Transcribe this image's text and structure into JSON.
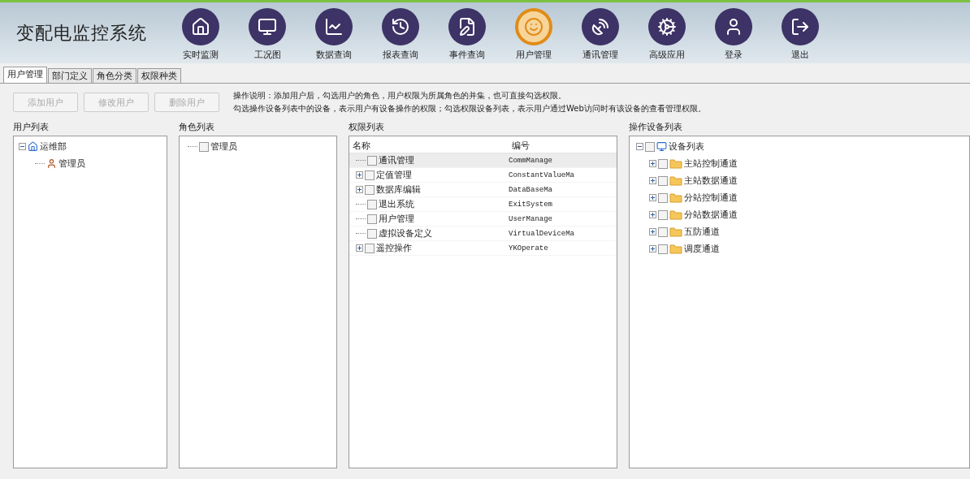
{
  "app_title": "变配电监控系统",
  "nav": [
    {
      "label": "实时监测",
      "selected": false
    },
    {
      "label": "工况图",
      "selected": false
    },
    {
      "label": "数据查询",
      "selected": false
    },
    {
      "label": "报表查询",
      "selected": false
    },
    {
      "label": "事件查询",
      "selected": false
    },
    {
      "label": "用户管理",
      "selected": true
    },
    {
      "label": "通讯管理",
      "selected": false
    },
    {
      "label": "高级应用",
      "selected": false
    },
    {
      "label": "登录",
      "selected": false
    },
    {
      "label": "退出",
      "selected": false
    }
  ],
  "tabs": [
    {
      "label": "用户管理",
      "selected": true
    },
    {
      "label": "部门定义",
      "selected": false
    },
    {
      "label": "角色分类",
      "selected": false
    },
    {
      "label": "权限种类",
      "selected": false
    }
  ],
  "buttons": [
    {
      "label": "添加用户",
      "disabled": true
    },
    {
      "label": "修改用户",
      "disabled": true
    },
    {
      "label": "删除用户",
      "disabled": true
    }
  ],
  "instructions": [
    "操作说明：添加用户后，勾选用户的角色，用户权限为所属角色的并集，也可直接勾选权限。",
    "勾选操作设备列表中的设备，表示用户有设备操作的权限；勾选权限设备列表，表示用户通过Web访问时有该设备的查看管理权限。"
  ],
  "user_list": {
    "title": "用户列表",
    "root": {
      "label": "运维部",
      "expanded": true,
      "children": [
        {
          "label": "管理员"
        }
      ]
    }
  },
  "role_list": {
    "title": "角色列表",
    "items": [
      {
        "label": "管理员",
        "checked": false
      }
    ]
  },
  "permission_list": {
    "title": "权限列表",
    "columns": [
      "名称",
      "编号"
    ],
    "rows": [
      {
        "name": "通讯管理",
        "code": "CommManage",
        "checked": false,
        "expandable": false,
        "selected": true
      },
      {
        "name": "定值管理",
        "code": "ConstantValueMa",
        "checked": false,
        "expandable": true,
        "selected": false
      },
      {
        "name": "数据库编辑",
        "code": "DataBaseMa",
        "checked": false,
        "expandable": true,
        "selected": false
      },
      {
        "name": "退出系统",
        "code": "ExitSystem",
        "checked": false,
        "expandable": false,
        "selected": false
      },
      {
        "name": "用户管理",
        "code": "UserManage",
        "checked": false,
        "expandable": false,
        "selected": false
      },
      {
        "name": "虚拟设备定义",
        "code": "VirtualDeviceMa",
        "checked": false,
        "expandable": false,
        "selected": false
      },
      {
        "name": "遥控操作",
        "code": "YKOperate",
        "checked": false,
        "expandable": true,
        "selected": false
      }
    ]
  },
  "device_list": {
    "title": "操作设备列表",
    "root": {
      "label": "设备列表",
      "checked": false,
      "expanded": true,
      "children": [
        {
          "label": "主站控制通道",
          "checked": false,
          "expanded": false
        },
        {
          "label": "主站数据通道",
          "checked": false,
          "expanded": false
        },
        {
          "label": "分站控制通道",
          "checked": false,
          "expanded": false
        },
        {
          "label": "分站数据通道",
          "checked": false,
          "expanded": false
        },
        {
          "label": "五防通道",
          "checked": false,
          "expanded": false
        },
        {
          "label": "调度通道",
          "checked": false,
          "expanded": false
        }
      ]
    }
  }
}
